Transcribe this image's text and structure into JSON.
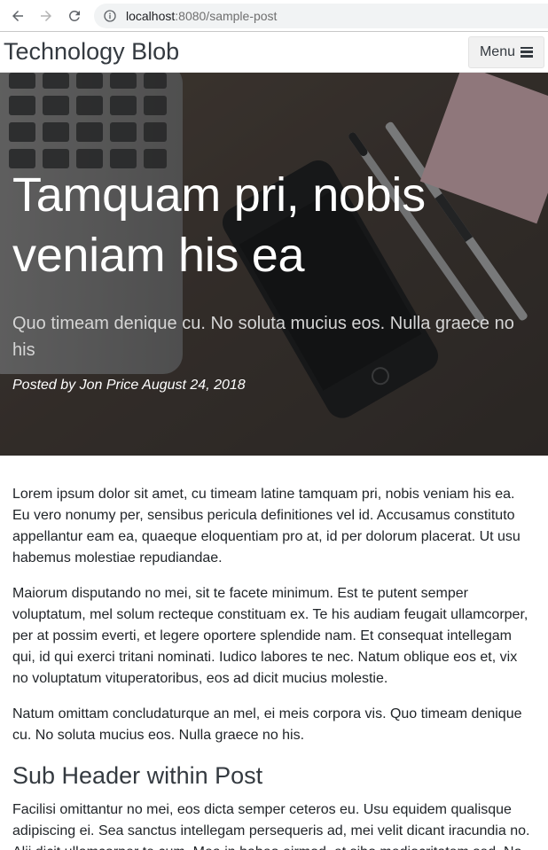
{
  "browser": {
    "url_host": "localhost",
    "url_rest": ":8080/sample-post"
  },
  "nav": {
    "brand": "Technology Blob",
    "menu_label": "Menu"
  },
  "hero": {
    "title": "Tamquam pri, nobis veniam his ea",
    "subtitle": "Quo timeam denique cu. No soluta mucius eos. Nulla graece no his",
    "meta": "Posted by Jon Price August 24, 2018"
  },
  "article": {
    "paragraphs": [
      "Lorem ipsum dolor sit amet, cu timeam latine tamquam pri, nobis veniam his ea. Eu vero nonumy per, sensibus pericula definitiones vel id. Accusamus constituto appellantur eam ea, quaeque eloquentiam pro at, id per dolorum placerat. Ut usu habemus molestiae repudiandae.",
      "Maiorum disputando no mei, sit te facete minimum. Est te putent semper voluptatum, mel solum recteque constituam ex. Te his audiam feugait ullamcorper, per at possim everti, et legere oportere splendide nam. Et consequat intellegam qui, id qui exerci tritani nominati. Iudico labores te nec. Natum oblique eos et, vix no voluptatum vituperatoribus, eos ad dicit mucius molestie.",
      "Natum omittam concludaturque an mel, ei meis corpora vis. Quo timeam denique cu. No soluta mucius eos. Nulla graece no his."
    ],
    "subheader": "Sub Header within Post",
    "paragraph_after_subheader": "Facilisi omittantur no mei, eos dicta semper ceteros eu. Usu equidem qualisque adipiscing ei. Sea sanctus intellegam persequeris ad, mei velit dicant iracundia no. Alii dicit ullamcorper te cum. Mea in habeo eirmod, et sibo mediocritatem sed. No"
  },
  "colors": {
    "brand_text": "#343a40",
    "hero_overlay": "#212529",
    "body_text": "#212529"
  }
}
